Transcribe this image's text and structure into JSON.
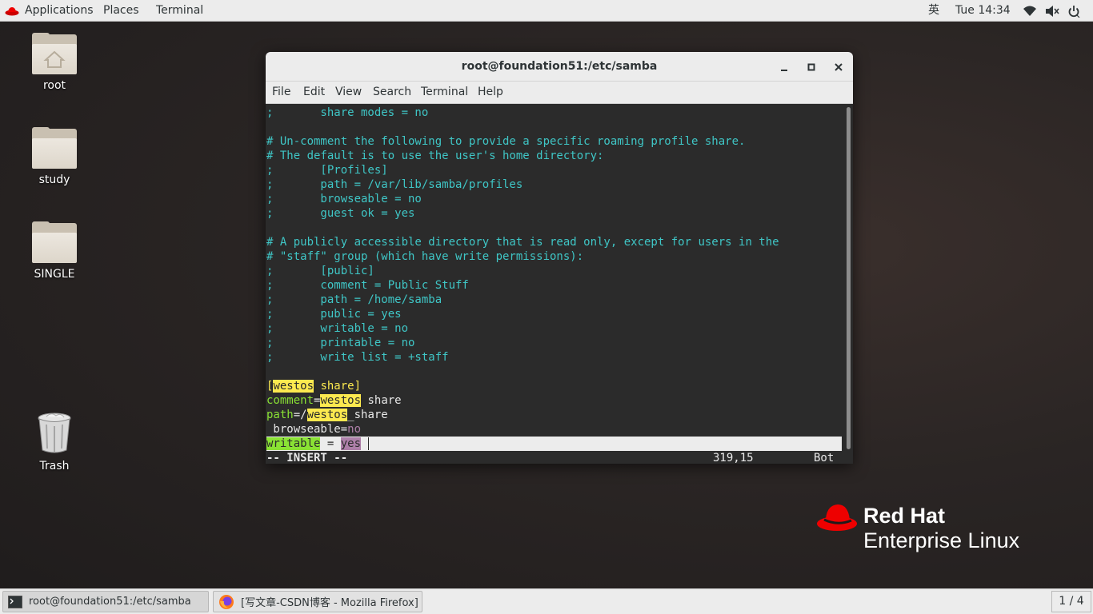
{
  "topbar": {
    "applications": "Applications",
    "places": "Places",
    "terminal": "Terminal",
    "ime": "英",
    "clock": "Tue 14:34",
    "icons": [
      "wifi-icon",
      "volume-muted-icon",
      "power-icon"
    ]
  },
  "desktop": {
    "icons": [
      {
        "label": "root",
        "icon": "home-folder-icon"
      },
      {
        "label": "study",
        "icon": "folder-icon"
      },
      {
        "label": "SINGLE",
        "icon": "folder-icon"
      },
      {
        "label": "Trash",
        "icon": "trash-icon"
      }
    ]
  },
  "window": {
    "title": "root@foundation51:/etc/samba",
    "menu": [
      "File",
      "Edit",
      "View",
      "Search",
      "Terminal",
      "Help"
    ]
  },
  "editor": {
    "lines": [
      ";       share modes = no",
      "",
      "# Un-comment the following to provide a specific roaming profile share.",
      "# The default is to use the user's home directory:",
      ";       [Profiles]",
      ";       path = /var/lib/samba/profiles",
      ";       browseable = no",
      ";       guest ok = yes",
      "",
      "# A publicly accessible directory that is read only, except for users in the",
      "# \"staff\" group (which have write permissions):",
      ";       [public]",
      ";       comment = Public Stuff",
      ";       path = /home/samba",
      ";       public = yes",
      ";       writable = no",
      ";       printable = no",
      ";       write list = +staff",
      ""
    ],
    "share_line": {
      "open": "[",
      "hl": "westos",
      "rest": " share]"
    },
    "comment_line": {
      "key": "comment",
      "eq": "=",
      "hl": "westos",
      "rest": " share"
    },
    "path_line": {
      "key": "path",
      "eq": "=/",
      "hl": "westos",
      "rest": "_share"
    },
    "browse_line": {
      "key": " browseable",
      "eq": "=",
      "val": "no"
    },
    "writable_line": {
      "key": "writable",
      "eq": " = ",
      "val": "yes"
    },
    "mode": "-- INSERT --",
    "position": "319,15",
    "scroll": "Bot"
  },
  "branding": {
    "line1": "Red Hat",
    "line2": "Enterprise Linux"
  },
  "taskbar": {
    "terminal_task": "root@foundation51:/etc/samba",
    "firefox_task": "[写文章-CSDN博客 - Mozilla Firefox]",
    "pager": "1 / 4"
  }
}
